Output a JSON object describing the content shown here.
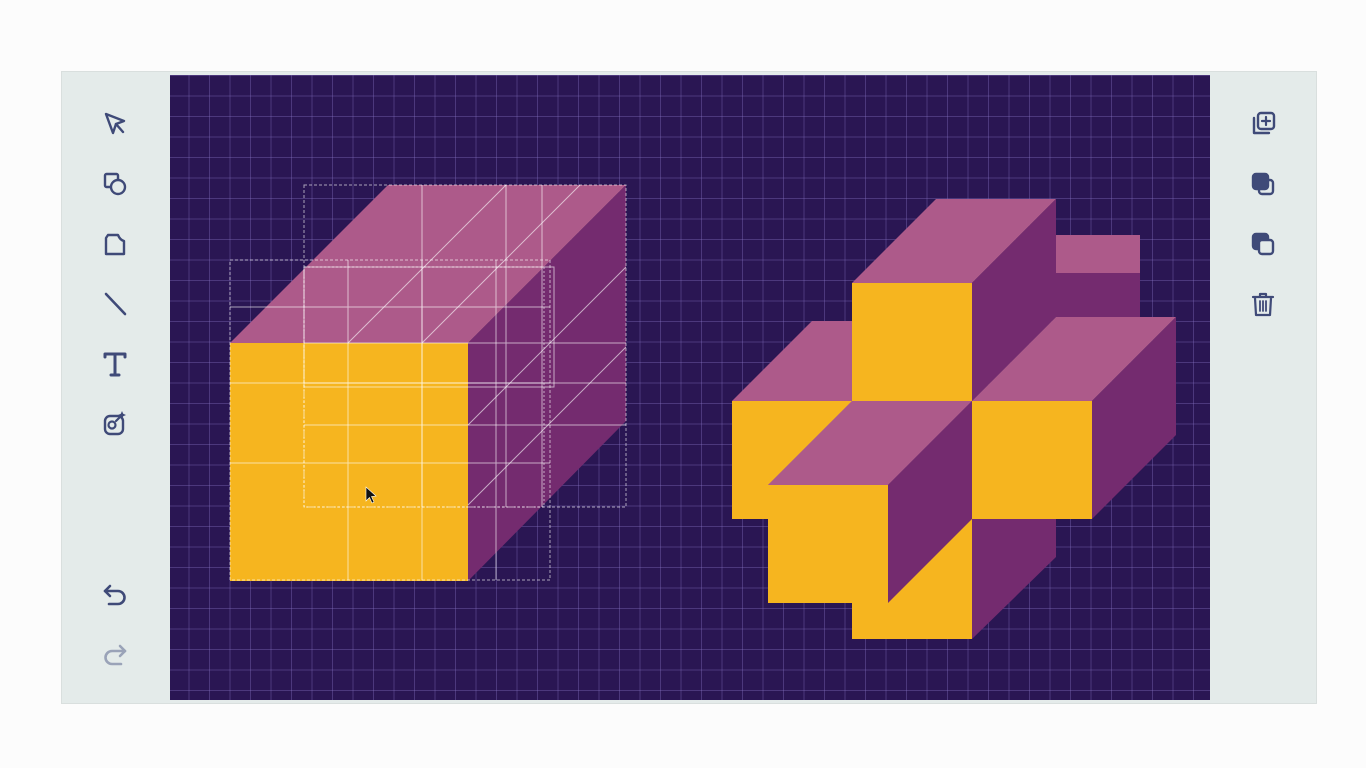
{
  "app": {
    "colors": {
      "panel": "#e4ebea",
      "canvas": "#2a1653",
      "grid": "#5b4a92",
      "icon": "#3f4a78",
      "icon_disabled": "#9aa3b8",
      "face_front": "#f6b51f",
      "face_top": "#ad5a8a",
      "face_side": "#742b6f",
      "selection": "#ffffff"
    }
  },
  "left_toolbar": {
    "tools": [
      {
        "name": "select",
        "icon": "cursor-arrow-icon"
      },
      {
        "name": "shapes",
        "icon": "shapes-icon"
      },
      {
        "name": "freeform",
        "icon": "freeform-shape-icon"
      },
      {
        "name": "line",
        "icon": "line-icon"
      },
      {
        "name": "text",
        "icon": "text-icon"
      },
      {
        "name": "sticker",
        "icon": "sticker-icon"
      }
    ],
    "history": [
      {
        "name": "undo",
        "icon": "undo-icon",
        "enabled": true
      },
      {
        "name": "redo",
        "icon": "redo-icon",
        "enabled": false
      }
    ]
  },
  "right_toolbar": {
    "actions": [
      {
        "name": "duplicate",
        "icon": "duplicate-icon"
      },
      {
        "name": "bring-to-front",
        "icon": "bring-to-front-icon"
      },
      {
        "name": "send-to-back",
        "icon": "send-to-back-icon"
      },
      {
        "name": "delete",
        "icon": "trash-icon"
      }
    ]
  },
  "canvas": {
    "objects": [
      {
        "name": "large-cube",
        "selected": true
      },
      {
        "name": "cube-cross-cluster",
        "selected": false
      }
    ]
  }
}
